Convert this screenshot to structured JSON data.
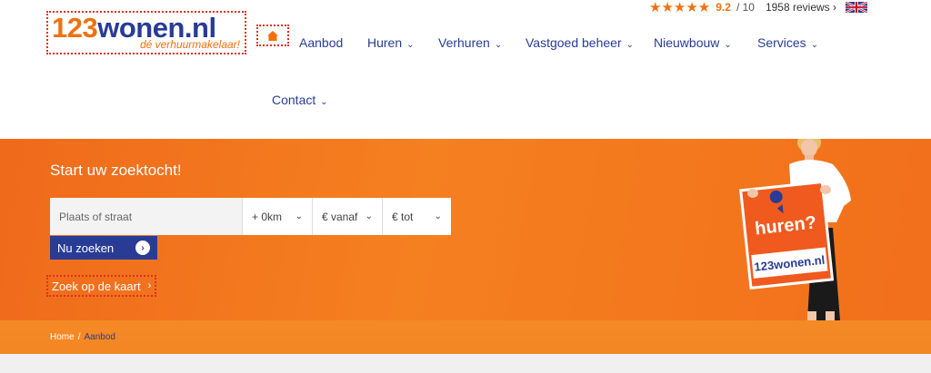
{
  "logo": {
    "text_num": "123",
    "text_main": "wonen.nl",
    "tagline": "dé verhuurmakelaar!"
  },
  "nav": {
    "items": [
      {
        "label": "Aanbod",
        "dropdown": false
      },
      {
        "label": "Huren",
        "dropdown": true
      },
      {
        "label": "Verhuren",
        "dropdown": true
      },
      {
        "label": "Vastgoed beheer",
        "dropdown": true
      },
      {
        "label": "Nieuwbouw",
        "dropdown": true
      },
      {
        "label": "Services",
        "dropdown": true
      },
      {
        "label": "Contact",
        "dropdown": true
      }
    ]
  },
  "rating": {
    "stars": 5,
    "score": "9.2",
    "scale": "/ 10",
    "reviews": "1958 reviews",
    "language": "EN"
  },
  "hero": {
    "title": "Start uw zoektocht!",
    "search": {
      "place_placeholder": "Plaats of straat",
      "radius": "+ 0km",
      "price_from": "€ vanaf",
      "price_to": "€ tot"
    },
    "search_button": "Nu zoeken",
    "map_link": "Zoek op de kaart",
    "sign_text": "huren?",
    "sign_logo": "123wonen.nl"
  },
  "breadcrumb": {
    "home": "Home",
    "separator": "/",
    "current": "Aanbod"
  },
  "colors": {
    "brand_blue": "#283c96",
    "brand_orange": "#f07010"
  }
}
